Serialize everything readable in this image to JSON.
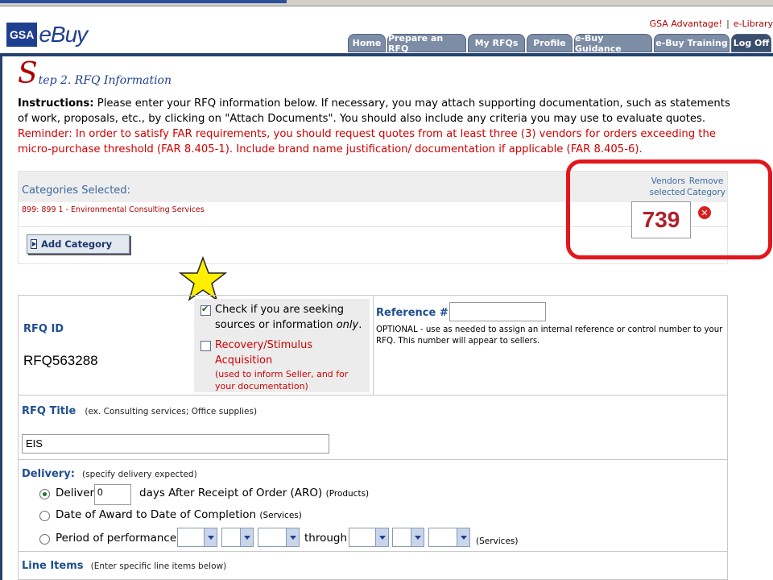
{
  "header": {
    "logo_gsa": "GSA",
    "logo_ebuy": "eBuy",
    "top_links": [
      "GSA Advantage!",
      "e-Library"
    ],
    "top_link_sep": "|",
    "nav_tabs": [
      "Home",
      "Prepare an RFQ",
      "My RFQs",
      "Profile",
      "e-Buy Guidance",
      "e-Buy Training",
      "Log Off"
    ]
  },
  "step": {
    "big_letter": "S",
    "title_rest": "tep 2. RFQ Information"
  },
  "instructions": {
    "label": "Instructions:",
    "text": " Please enter your RFQ information below. If necessary, you may attach supporting documentation, such as statements of work, proposals, etc., by clicking on \"Attach Documents\". You should also include any criteria you may use to evaluate quotes.",
    "reminder": "Reminder: In order to satisfy FAR requirements, you should request quotes from at least three (3) vendors for orders exceeding the micro-purchase threshold (FAR 8.405-1). Include brand name justification/ documentation if applicable (FAR 8.405-6)."
  },
  "categories": {
    "label": "Categories Selected:",
    "vendors_selected_label": "Vendors selected",
    "remove_category_label": "Remove Category",
    "items": [
      {
        "text": "899: 899 1 - Environmental Consulting Services",
        "vendor_count": "739"
      }
    ],
    "remove_icon": "remove-x-icon",
    "add_button": "Add Category"
  },
  "rfq": {
    "id_label": "RFQ ID",
    "id_value": "RFQ563288",
    "sources_check_text": "Check if you are seeking sources or information",
    "sources_check_emph": "only",
    "sources_checked": true,
    "recovery_text": "Recovery/Stimulus Acquisition",
    "recovery_note": "(used to inform Seller, and for your documentation)",
    "recovery_checked": false,
    "reference_label": "Reference #",
    "reference_value": "",
    "reference_note": "OPTIONAL - use as needed to assign an internal reference or control number to your RFQ. This number will appear to sellers."
  },
  "title": {
    "label": "RFQ Title",
    "hint": "(ex. Consulting services; Office supplies)",
    "value": "EIS"
  },
  "delivery": {
    "label": "Delivery:",
    "hint": "(specify delivery expected)",
    "option_deliver": "Deliver",
    "days_value": "0",
    "option_deliver_suffix": "days After Receipt of Order (ARO)",
    "option_deliver_note": "(Products)",
    "option_award": "Date of Award to Date of Completion",
    "option_award_note": "(Services)",
    "option_period": "Period of performance:",
    "through": "through",
    "option_period_note": "(Services)",
    "selected": "deliver"
  },
  "line_items": {
    "label": "Line Items",
    "hint": "(Enter specific line items below)"
  },
  "colors": {
    "brand_blue": "#1f3f8f",
    "accent_red": "#d00000",
    "highlight_red": "#e3161c",
    "star_yellow": "#ffee00"
  }
}
